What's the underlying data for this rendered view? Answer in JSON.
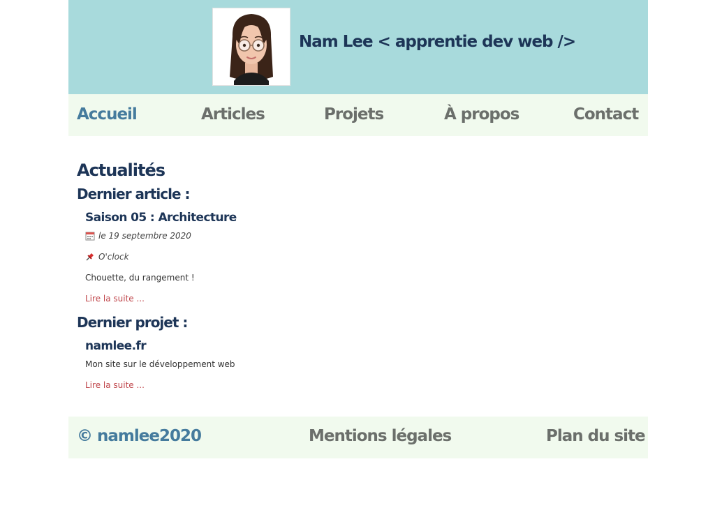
{
  "header": {
    "title": "Nam Lee < apprentie dev web />",
    "avatar_icon": "avatar-memoji-icon"
  },
  "nav": {
    "items": [
      {
        "label": "Accueil",
        "active": true
      },
      {
        "label": "Articles",
        "active": false
      },
      {
        "label": "Projets",
        "active": false
      },
      {
        "label": "À propos",
        "active": false
      },
      {
        "label": "Contact",
        "active": false
      }
    ]
  },
  "main": {
    "heading": "Actualités",
    "last_article": {
      "heading": "Dernier article :",
      "title": "Saison 05 : Architecture",
      "date": "le 19 septembre 2020",
      "date_icon": "calendar-icon",
      "category": "O'clock",
      "category_icon": "pin-icon",
      "excerpt": "Chouette, du rangement !",
      "read_more": "Lire la suite ..."
    },
    "last_project": {
      "heading": "Dernier projet :",
      "title": "namlee.fr",
      "excerpt": "Mon site sur le développement web",
      "read_more": "Lire la suite ..."
    }
  },
  "footer": {
    "copyright": "© namlee2020",
    "legal": "Mentions légales",
    "sitemap": "Plan du site"
  },
  "colors": {
    "header_bg": "#a8dadc",
    "nav_bg": "#f1faee",
    "dark_blue": "#1d3557",
    "accent_blue": "#457b9d",
    "link_red": "#c0474c"
  }
}
